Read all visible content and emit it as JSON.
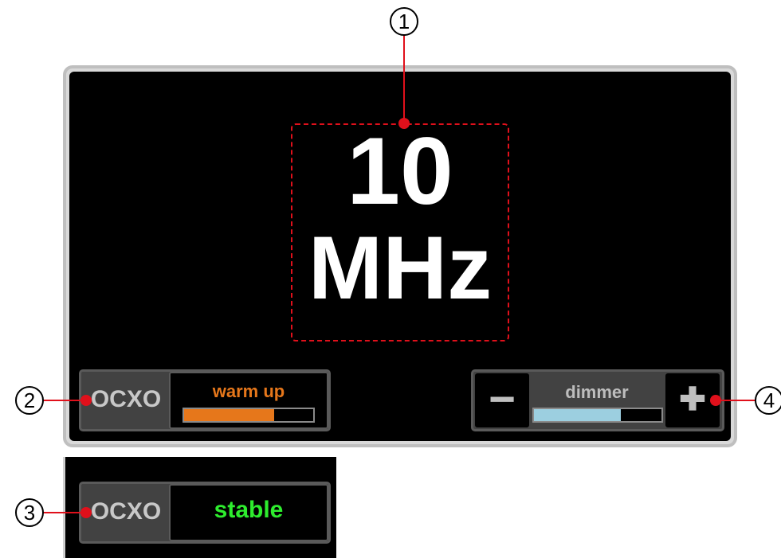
{
  "display": {
    "frequency_value": "10",
    "frequency_unit": "MHz"
  },
  "ocxo_warmup": {
    "label": "OCXO",
    "status": "warm up",
    "progress": 0.7,
    "progress_color": "#e6771b"
  },
  "ocxo_stable": {
    "label": "OCXO",
    "status": "stable",
    "status_color": "#2eed2e"
  },
  "dimmer": {
    "label": "dimmer",
    "minus_label": "−",
    "plus_label": "✚",
    "level": 0.68,
    "level_color": "#9ccfe0"
  },
  "callouts": {
    "c1": "1",
    "c2": "2",
    "c3": "3",
    "c4": "4"
  },
  "colors": {
    "callout_red": "#e0101b",
    "screen_bg": "#000000"
  }
}
